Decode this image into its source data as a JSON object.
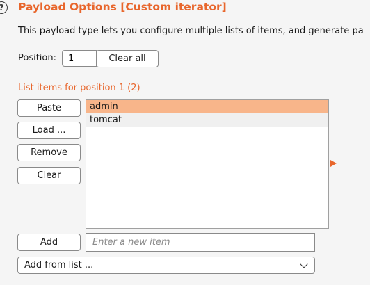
{
  "header": {
    "help_glyph": "?",
    "title": "Payload Options [Custom iterator]",
    "description": "This payload type lets you configure multiple lists of items, and generate pa"
  },
  "position": {
    "label": "Position:",
    "value": "1",
    "clear_all_label": "Clear all"
  },
  "list_section": {
    "label": "List items for position 1 (2)",
    "buttons": {
      "paste": "Paste",
      "load": "Load ...",
      "remove": "Remove",
      "clear": "Clear"
    },
    "items": [
      "admin",
      "tomcat"
    ],
    "selected_index": 0
  },
  "add_row": {
    "add_label": "Add",
    "placeholder": "Enter a new item"
  },
  "add_from_list": {
    "label": "Add from list ..."
  },
  "colors": {
    "accent": "#e8662c",
    "selected_row": "#f8b58a"
  }
}
